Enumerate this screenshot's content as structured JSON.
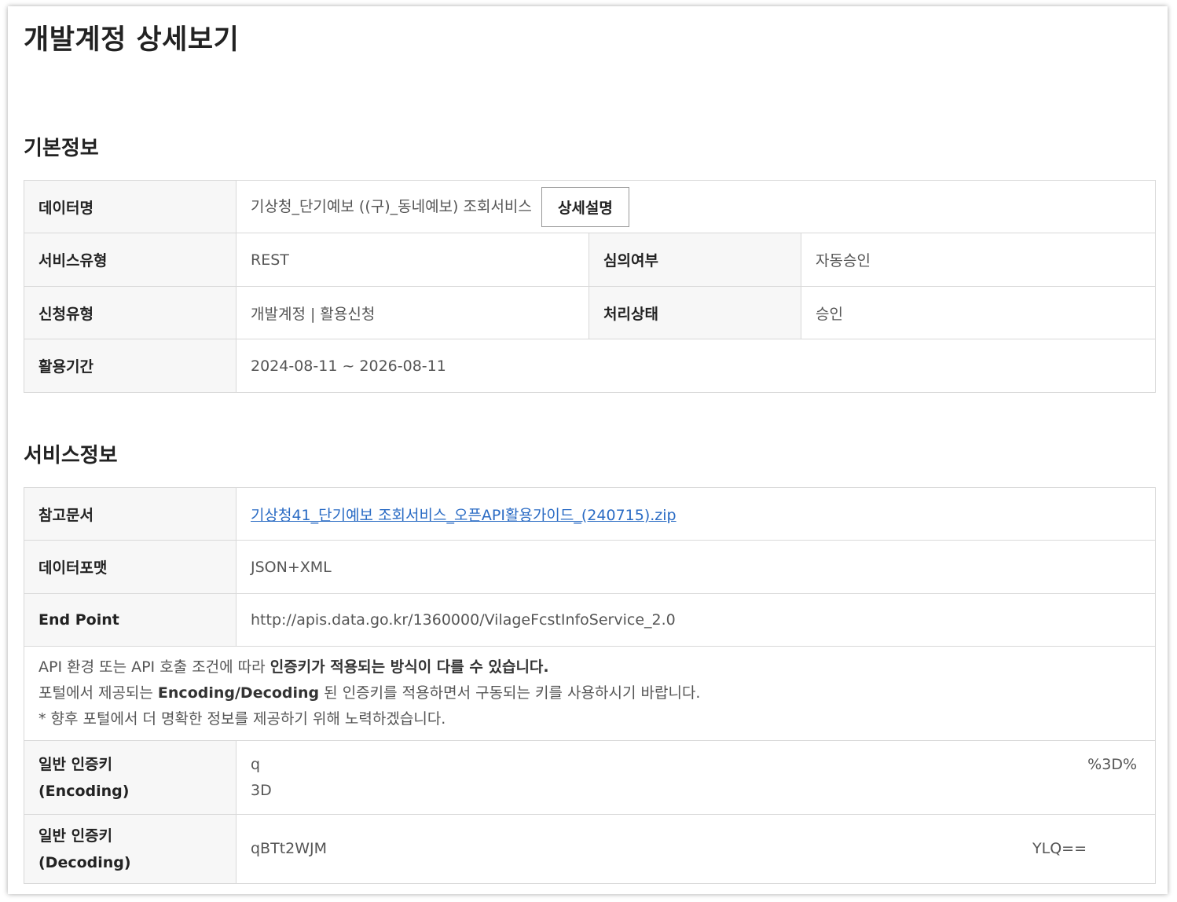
{
  "page_title": "개발계정 상세보기",
  "basic": {
    "section_title": "기본정보",
    "data_name_label": "데이터명",
    "data_name_value": "기상청_단기예보 ((구)_동네예보) 조회서비스",
    "detail_button": "상세설명",
    "service_type_label": "서비스유형",
    "service_type_value": "REST",
    "review_label": "심의여부",
    "review_value": "자동승인",
    "request_type_label": "신청유형",
    "request_type_value": "개발계정 | 활용신청",
    "status_label": "처리상태",
    "status_value": "승인",
    "period_label": "활용기간",
    "period_value": "2024-08-11 ~ 2026-08-11"
  },
  "service": {
    "section_title": "서비스정보",
    "ref_doc_label": "참고문서",
    "ref_doc_link": "기상청41_단기예보 조회서비스_오픈API활용가이드_(240715).zip",
    "format_label": "데이터포맷",
    "format_value": "JSON+XML",
    "endpoint_label": "End Point",
    "endpoint_value": "http://apis.data.go.kr/1360000/VilageFcstInfoService_2.0",
    "notice_line1_a": "API 환경 또는 API 호출 조건에 따라 ",
    "notice_line1_b": "인증키가 적용되는 방식이 다를 수 있습니다.",
    "notice_line2_a": "포털에서 제공되는 ",
    "notice_line2_b": "Encoding/Decoding",
    "notice_line2_c": " 된 인증키를 적용하면서 구동되는 키를 사용하시기 바랍니다.",
    "notice_line3": "* 향후 포털에서 더 명확한 정보를 제공하기 위해 노력하겠습니다.",
    "key_enc_label_1": "일반 인증키",
    "key_enc_label_2": "(Encoding)",
    "key_enc_value_start": "q",
    "key_enc_value_end": "%3D%",
    "key_enc_value_line2": "3D",
    "key_dec_label_1": "일반 인증키",
    "key_dec_label_2": "(Decoding)",
    "key_dec_value_start": "qBTt2WJM",
    "key_dec_value_end": "YLQ=="
  }
}
